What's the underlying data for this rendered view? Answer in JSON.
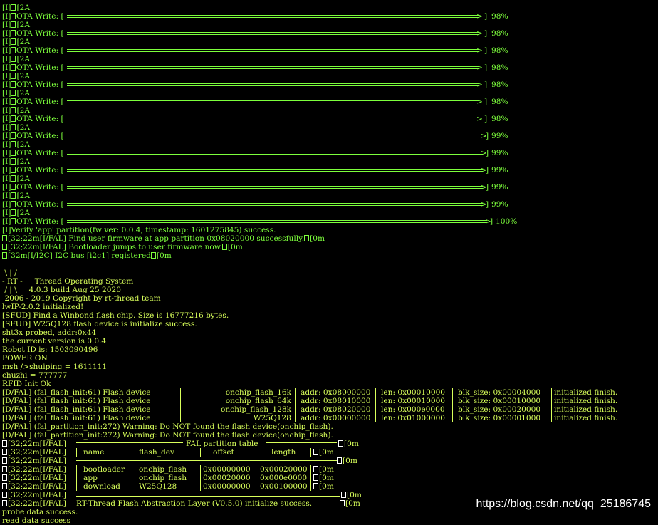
{
  "ota": {
    "prefix": "[I]",
    "esc": "[2A",
    "label": "OTA Write: [",
    "bar_open": "[",
    "bar_close": "]",
    "rows": [
      {
        "pct_text": "98%",
        "fraction": 0.98
      },
      {
        "pct_text": "98%",
        "fraction": 0.98
      },
      {
        "pct_text": "98%",
        "fraction": 0.98
      },
      {
        "pct_text": "98%",
        "fraction": 0.98
      },
      {
        "pct_text": "98%",
        "fraction": 0.98
      },
      {
        "pct_text": "98%",
        "fraction": 0.98
      },
      {
        "pct_text": "98%",
        "fraction": 0.98
      },
      {
        "pct_text": "99%",
        "fraction": 0.99
      },
      {
        "pct_text": "99%",
        "fraction": 0.99
      },
      {
        "pct_text": "99%",
        "fraction": 0.99
      },
      {
        "pct_text": "99%",
        "fraction": 0.99
      },
      {
        "pct_text": "99%",
        "fraction": 0.99
      },
      {
        "pct_text": "100%",
        "fraction": 1.0
      }
    ]
  },
  "boot": {
    "verify": "[I]Verify 'app' partition(fw ver: 0.0.4, timestamp: 1601275845) success.",
    "find": "[32;22m[I/FAL] Find user firmware at app partition 0x08020000 successfully.",
    "find_tail": "[0m",
    "jump": "[32;22m[I/FAL] Bootloader jumps to user firmware now.",
    "jump_tail": "[0m",
    "i2c": "[32m[I/I2C] I2C bus [i2c1] registered",
    "i2c_tail": "[0m"
  },
  "rtt": {
    "logo1": " \\ | /",
    "logo2": "- RT -     Thread Operating System",
    "logo3": " / | \\     4.0.3 build Aug 25 2020",
    "logo4": " 2006 - 2019 Copyright by rt-thread team",
    "lwip": "lwIP-2.0.2 initialized!",
    "sfud1": "[SFUD] Find a Winbond flash chip. Size is 16777216 bytes.",
    "sfud2": "[SFUD] W25Q128 flash device is initialize success.",
    "sht3x": "sht3x probed, addr:0x44",
    "version": "the current version is 0.0.4",
    "robot": "Robot ID is: 1503090496",
    "power": "POWER ON",
    "msh": "msh />shuiping = 1611111",
    "chuzhi": "chuzhi = 777777",
    "rfid": "RFID Init Ok"
  },
  "fal_init": {
    "prefix": "[D/FAL] (fal_flash_init:61) Flash device",
    "rows": [
      {
        "name": "onchip_flash_16k",
        "addr": "addr: 0x08000000",
        "len": "len: 0x00010000",
        "blk": "blk_size: 0x00004000",
        "status": "initialized finish."
      },
      {
        "name": "onchip_flash_64k",
        "addr": "addr: 0x08010000",
        "len": "len: 0x00010000",
        "blk": "blk_size: 0x00010000",
        "status": "initialized finish."
      },
      {
        "name": "onchip_flash_128k",
        "addr": "addr: 0x08020000",
        "len": "len: 0x000e0000",
        "blk": "blk_size: 0x00020000",
        "status": "initialized finish."
      },
      {
        "name": "W25Q128",
        "addr": "addr: 0x00000000",
        "len": "len: 0x01000000",
        "blk": "blk_size: 0x00001000",
        "status": "initialized finish."
      }
    ]
  },
  "fal_warn": [
    "[D/FAL] (fal_partition_init:272) Warning: Do NOT found the flash device(onchip_flash).",
    "[D/FAL] (fal_partition_init:272) Warning: Do NOT found the flash device(onchip_flash)."
  ],
  "fal_table": {
    "prefix": "[32;22m[I/FAL]",
    "tail": "[0m",
    "title": "FAL partition table",
    "headers": [
      "name",
      "flash_dev",
      "offset",
      "length"
    ],
    "rows": [
      {
        "name": "bootloader",
        "dev": "onchip_flash",
        "offset": "0x00000000",
        "length": "0x00020000"
      },
      {
        "name": "app",
        "dev": "onchip_flash",
        "offset": "0x00020000",
        "length": "0x000e0000"
      },
      {
        "name": "download",
        "dev": "W25Q128",
        "offset": "0x00000000",
        "length": "0x00100000"
      }
    ],
    "fal_init_msg": "RT-Thread Flash Abstraction Layer (V0.5.0) initialize success."
  },
  "probe": "probe data success.",
  "read": "read data success",
  "watermark": "https://blog.csdn.net/qq_25186745"
}
